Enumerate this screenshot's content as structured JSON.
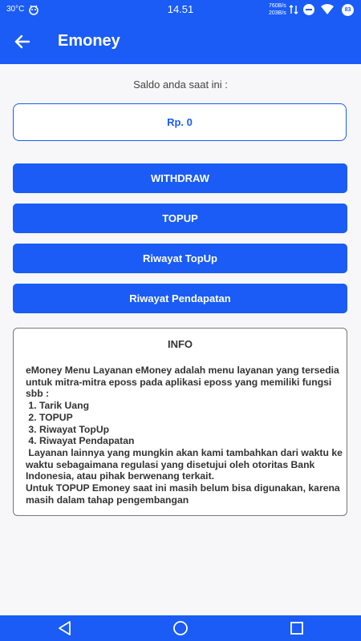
{
  "status_bar": {
    "temperature": "30°C",
    "time": "14.51",
    "net_up": "760B/s",
    "net_down": "203B/s",
    "battery": "83",
    "icons": [
      "bug-icon",
      "data-arrows-icon",
      "dnd-icon",
      "wifi-icon",
      "battery-icon"
    ]
  },
  "app_bar": {
    "title": "Emoney",
    "back_icon": "arrow-left-icon"
  },
  "balance": {
    "label": "Saldo anda saat ini :",
    "value": "Rp. 0"
  },
  "buttons": {
    "withdraw": "WITHDRAW",
    "topup": "TOPUP",
    "riwayat_topup": "Riwayat TopUp",
    "riwayat_pendapatan": "Riwayat Pendapatan"
  },
  "info": {
    "title": "INFO",
    "text": "eMoney Menu Layanan eMoney adalah menu layanan yang tersedia untuk mitra-mitra eposs pada aplikasi eposs yang memiliki fungsi sbb :\n 1. Tarik Uang\n 2. TOPUP\n 3. Riwayat TopUp\n 4. Riwayat Pendapatan\n Layanan lainnya yang mungkin akan kami tambahkan dari waktu ke waktu sebagaimana regulasi yang disetujui oleh otoritas Bank Indonesia, atau pihak berwenang terkait.\nUntuk TOPUP Emoney saat ini masih belum bisa digunakan, karena masih dalam tahap pengembangan"
  },
  "nav_bar": {
    "icons": [
      "back-triangle-icon",
      "home-circle-icon",
      "recents-square-icon"
    ]
  },
  "colors": {
    "primary": "#1a5cf5",
    "background": "#f7f7f9"
  }
}
